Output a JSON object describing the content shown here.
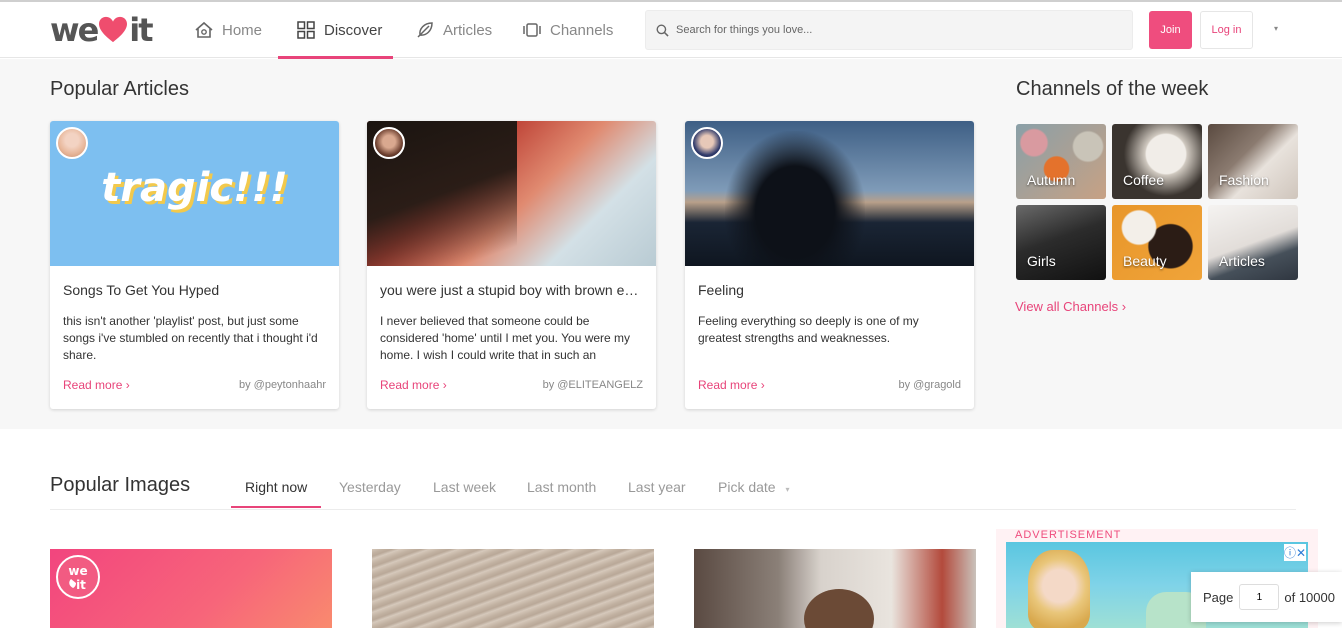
{
  "header": {
    "logo": {
      "left": "we",
      "right": "it"
    },
    "nav": [
      {
        "label": "Home",
        "icon": "home-icon"
      },
      {
        "label": "Discover",
        "icon": "grid-icon"
      },
      {
        "label": "Articles",
        "icon": "feather-icon"
      },
      {
        "label": "Channels",
        "icon": "channels-icon"
      }
    ],
    "active_nav": "Discover",
    "search_placeholder": "Search for things you love...",
    "join_label": "Join",
    "login_label": "Log in",
    "menu_caret": "▾"
  },
  "popular_articles": {
    "title": "Popular Articles",
    "more_label": "Read more ›",
    "cards": [
      {
        "image_text": "tragic!!!",
        "title": "Songs To Get You Hyped",
        "desc": "this isn't another 'playlist' post, but just some songs i've stumbled on recently that i thought i'd share.",
        "author": "by @peytonhaahr"
      },
      {
        "title": "you were just a stupid boy with brown eyes",
        "desc": "I never believed that someone could be considered 'home' until I met you. You were my home. I wish I could write that in such an",
        "author": "by @ELITEANGELZ"
      },
      {
        "title": "Feeling",
        "desc": "Feeling everything so deeply is one of my greatest strengths and weaknesses.",
        "author": "by @gragold"
      }
    ]
  },
  "channels": {
    "title": "Channels of the week",
    "items": [
      "Autumn",
      "Coffee",
      "Fashion",
      "Girls",
      "Beauty",
      "Articles"
    ],
    "view_all": "View all Channels ›"
  },
  "popular_images": {
    "title": "Popular Images",
    "tabs": [
      "Right now",
      "Yesterday",
      "Last week",
      "Last month",
      "Last year",
      "Pick date"
    ],
    "active_tab": "Right now",
    "pick_caret": "▾"
  },
  "ad": {
    "label": "ADVERTISEMENT",
    "close_icons": "ⓘ✕"
  },
  "pager": {
    "label": "Page",
    "value": "1",
    "of_label": "of 10000"
  },
  "colors": {
    "accent": "#e8447a",
    "join_bg": "#ef4d7e",
    "band_bg": "#f7f7f7"
  }
}
